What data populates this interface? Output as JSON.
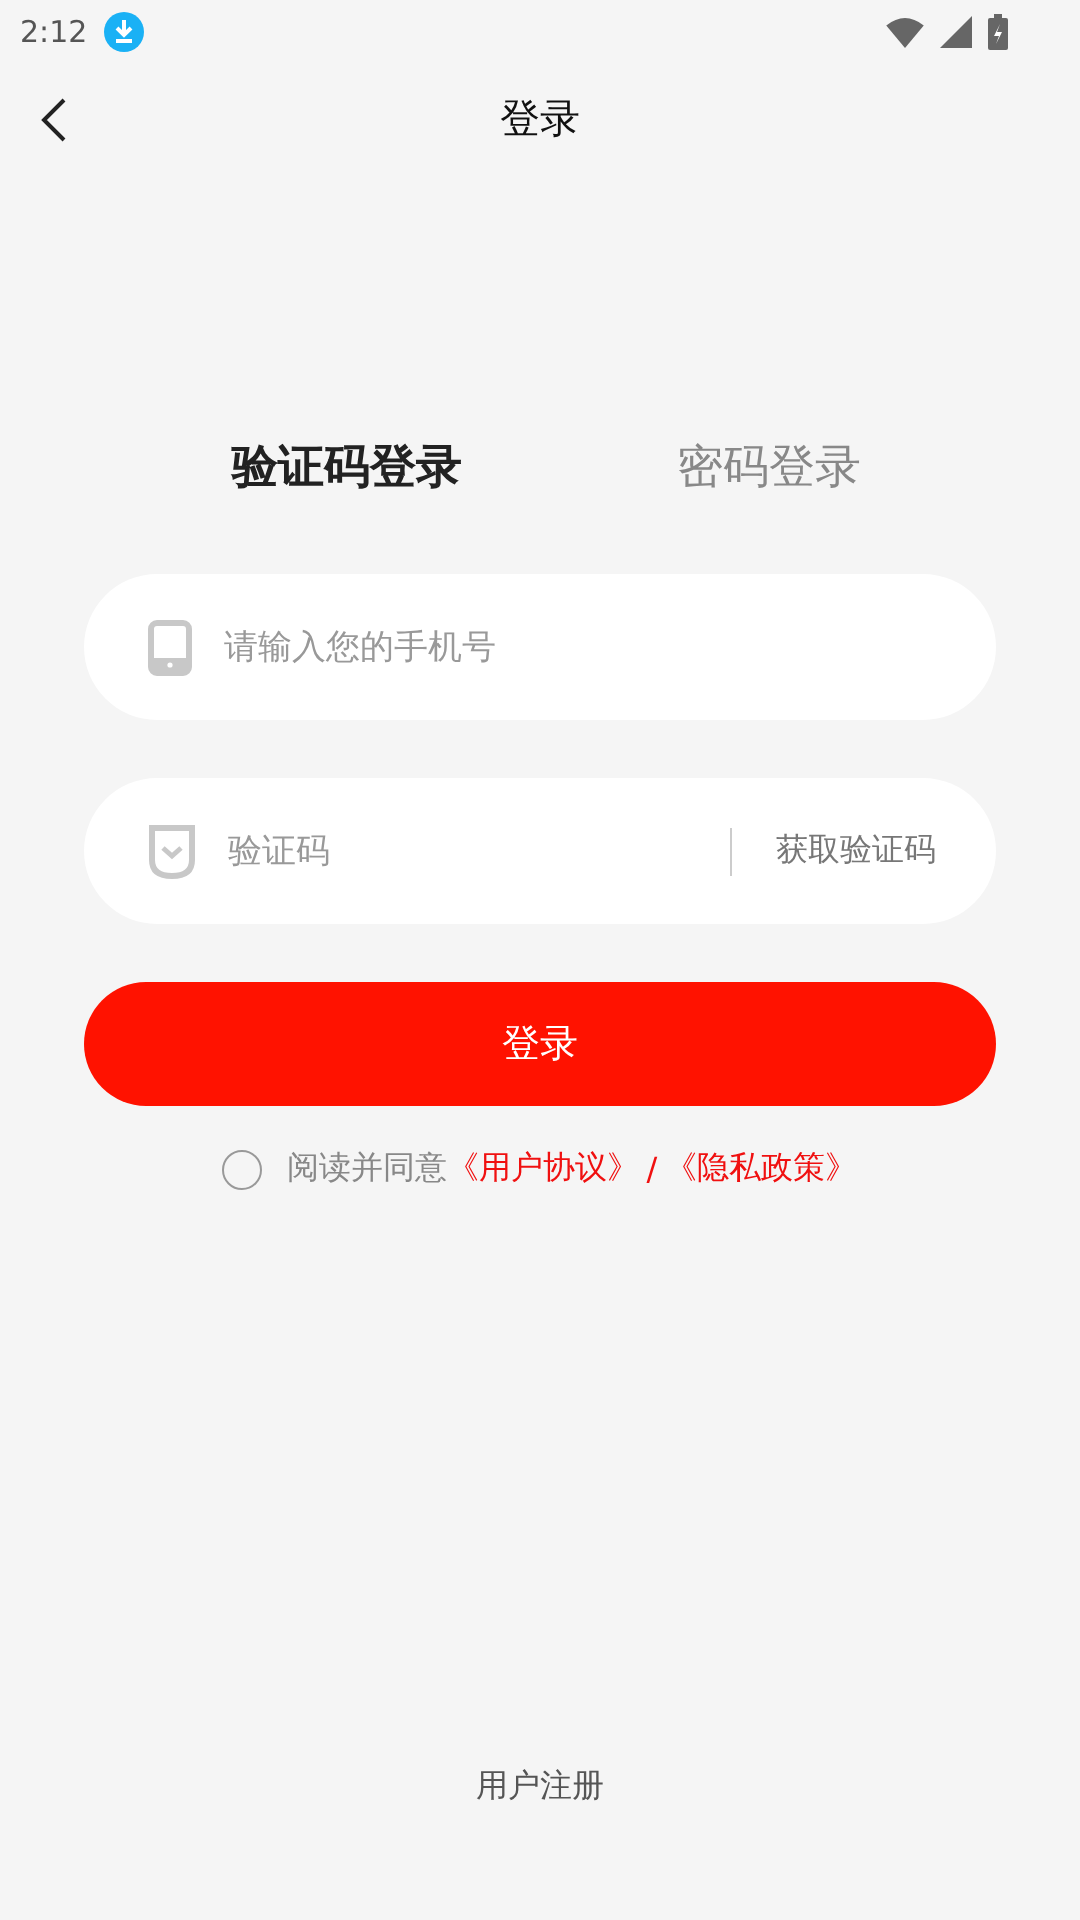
{
  "status_bar": {
    "time": "2:12"
  },
  "header": {
    "title": "登录"
  },
  "tabs": [
    {
      "label": "验证码登录",
      "selected": true
    },
    {
      "label": "密码登录",
      "selected": false
    }
  ],
  "phone_field": {
    "placeholder": "请输入您的手机号"
  },
  "code_field": {
    "placeholder": "验证码",
    "action": "获取验证码"
  },
  "login_button": "登录",
  "agreement": {
    "checked": false,
    "text": "阅读并同意",
    "links": [
      "《用户协议》",
      "《隐私政策》"
    ],
    "separator": "/"
  },
  "register_link": "用户注册"
}
